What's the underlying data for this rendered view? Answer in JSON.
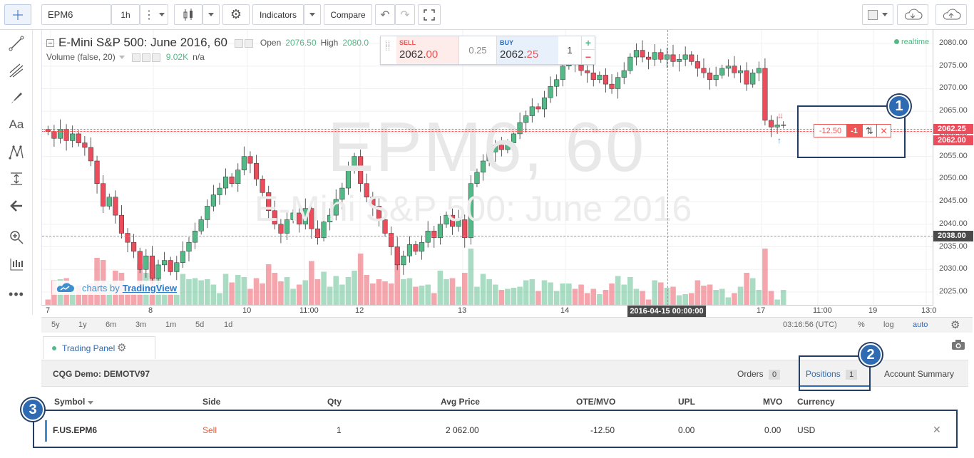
{
  "toolbar": {
    "symbol": "EPM6",
    "interval": "1h",
    "indicators_label": "Indicators",
    "compare_label": "Compare"
  },
  "legend": {
    "title": "E-Mini S&P 500: June 2016, 60",
    "open_label": "Open",
    "open_value": "2076.50",
    "high_label": "High",
    "high_value": "2080.0",
    "volume_label": "Volume (false, 20)",
    "volume_value": "9.02K",
    "volume_na": "n/a",
    "realtime": "realtime"
  },
  "watermark": {
    "line1": "EPM6, 60",
    "line2": "E-Mini S&P 500: June 2016"
  },
  "branding": {
    "prefix": "charts by",
    "name": "TradingView"
  },
  "ticket": {
    "sell_label": "SELL",
    "sell_price_main": "2062.",
    "sell_price_frac": "00",
    "spread": "0.25",
    "buy_label": "BUY",
    "buy_price_main": "2062.",
    "buy_price_frac": "25",
    "qty": "1",
    "plus": "+",
    "minus": "−"
  },
  "position_line": {
    "pnl": "-12.50",
    "qty": "-1",
    "reverse": "⇅",
    "close": "✕"
  },
  "price_axis": {
    "ticks": [
      "2080.00",
      "2075.00",
      "2070.00",
      "2065.00",
      "2060.00",
      "2055.00",
      "2050.00",
      "2045.00",
      "2040.00",
      "2035.00",
      "2030.00",
      "2025.00"
    ],
    "ask_label": "2062.25",
    "bid_label": "2062.00",
    "cross_label": "2038.00"
  },
  "time_axis": {
    "ticks": [
      "7",
      "8",
      "10",
      "11:00",
      "12",
      "13",
      "14",
      "17",
      "11:00",
      "19",
      "13:0"
    ],
    "cursor_label": "2016-04-15 00:00:00"
  },
  "bottom_bar": {
    "ranges": [
      "5y",
      "1y",
      "6m",
      "3m",
      "1m",
      "5d",
      "1d"
    ],
    "clock": "03:16:56 (UTC)",
    "percent": "%",
    "log": "log",
    "auto": "auto"
  },
  "panel": {
    "tab_label": "Trading Panel",
    "account": "CQG Demo: DEMOTV97",
    "tabs": [
      {
        "label": "Orders",
        "count": "0"
      },
      {
        "label": "Positions",
        "count": "1"
      },
      {
        "label": "Account Summary"
      }
    ],
    "columns": [
      "Symbol",
      "Side",
      "Qty",
      "Avg Price",
      "OTE/MVO",
      "UPL",
      "MVO",
      "Currency"
    ],
    "rows": [
      {
        "symbol": "F.US.EPM6",
        "side": "Sell",
        "qty": "1",
        "avg_price": "2 062.00",
        "ote": "-12.50",
        "upl": "0.00",
        "mvo": "0.00",
        "currency": "USD",
        "close": "✕"
      }
    ]
  },
  "callouts": [
    "1",
    "2",
    "3"
  ],
  "colors": {
    "up": "#53b987",
    "down": "#eb4d5c",
    "accent": "#2f6bb3",
    "callout": "#243e63"
  },
  "chart_data": {
    "type": "candlestick",
    "y_range": [
      2022,
      2083
    ],
    "closes": [
      2060.5,
      2059.0,
      2061.0,
      2058.5,
      2060.0,
      2058.0,
      2057.0,
      2054.0,
      2049.0,
      2044.0,
      2046.0,
      2042.0,
      2038.0,
      2036.0,
      2034.0,
      2030.0,
      2033.0,
      2028.0,
      2031.0,
      2032.0,
      2029.5,
      2031.5,
      2034.0,
      2036.0,
      2038.5,
      2041.0,
      2044.0,
      2046.5,
      2048.0,
      2050.5,
      2049.0,
      2052.0,
      2055.0,
      2053.5,
      2050.0,
      2047.0,
      2043.0,
      2040.0,
      2038.0,
      2041.0,
      2042.5,
      2040.0,
      2043.5,
      2039.0,
      2037.0,
      2040.5,
      2042.0,
      2045.5,
      2048.0,
      2052.0,
      2055.0,
      2049.0,
      2046.0,
      2044.0,
      2041.0,
      2038.0,
      2035.0,
      2031.0,
      2033.0,
      2035.5,
      2034.0,
      2036.0,
      2038.5,
      2037.0,
      2040.0,
      2042.0,
      2039.5,
      2041.0,
      2037.0,
      2049.0,
      2051.5,
      2054.0,
      2056.0,
      2057.5,
      2056.5,
      2058.0,
      2060.0,
      2062.5,
      2064.0,
      2066.0,
      2065.5,
      2068.0,
      2070.5,
      2072.0,
      2075.0,
      2076.0,
      2075.5,
      2074.0,
      2073.5,
      2072.0,
      2073.0,
      2071.0,
      2070.0,
      2072.5,
      2074.0,
      2077.0,
      2078.5,
      2077.0,
      2076.5,
      2078.0,
      2076.5,
      2077.5,
      2076.0,
      2076.5,
      2077.5,
      2076.0,
      2074.5,
      2073.5,
      2072.0,
      2073.0,
      2074.5,
      2075.0,
      2073.5,
      2074.0,
      2071.0,
      2073.5,
      2074.5,
      2063.0,
      2061.5,
      2062.0,
      2062.0
    ]
  }
}
